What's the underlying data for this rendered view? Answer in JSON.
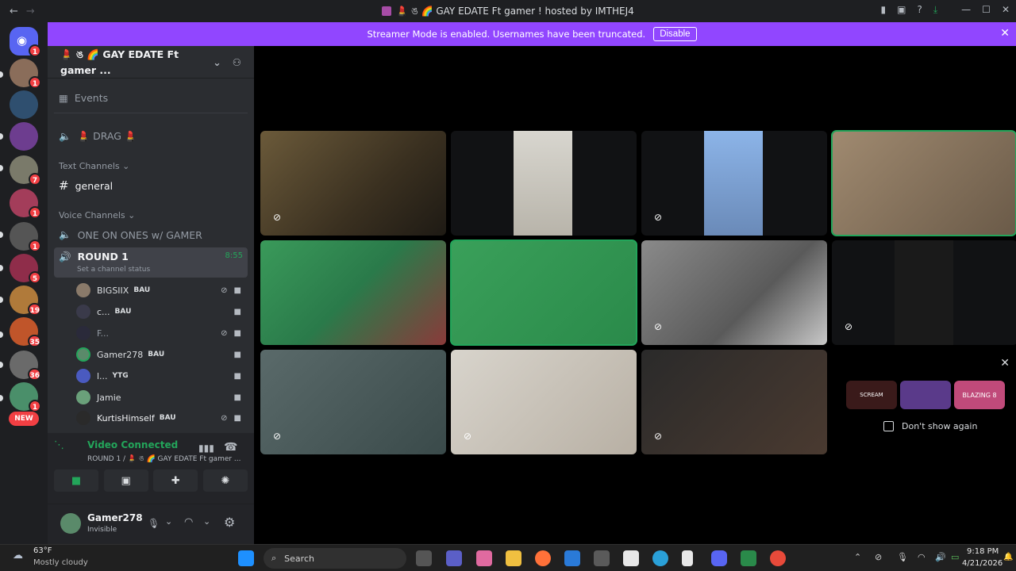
{
  "window": {
    "title": "💄 ঙ 🌈 GAY EDATE Ft gamer ! hosted by IMTHEJ4"
  },
  "banner": {
    "text": "Streamer Mode is enabled. Usernames have been truncated.",
    "disable_label": "Disable",
    "color": "#9146ff"
  },
  "guilds": {
    "badges": [
      "1",
      "1",
      "7",
      "1",
      "1",
      "5",
      "19",
      "35",
      "36",
      "1"
    ],
    "new_label": "NEW"
  },
  "server": {
    "name": "💄 ঙ 🌈 GAY EDATE Ft gamer ...",
    "events_label": "Events",
    "drag_channel": "💄 DRAG 💄",
    "text_category": "Text Channels",
    "general": "general",
    "voice_category": "Voice Channels",
    "one_on_ones": "ONE ON ONES w/ GAMER",
    "round1": "ROUND 1",
    "round1_timer": "8:55",
    "channel_status": "Set a channel status"
  },
  "members": [
    {
      "name": "BIGSIIX",
      "tag": "BAU"
    },
    {
      "name": "c...",
      "tag": "BAU"
    },
    {
      "name": "F...",
      "tag": ""
    },
    {
      "name": "Gamer278",
      "tag": "BAU"
    },
    {
      "name": "l...",
      "tag": "YTG"
    },
    {
      "name": "Jamie",
      "tag": ""
    },
    {
      "name": "KurtisHimself",
      "tag": "BAU"
    }
  ],
  "voice_panel": {
    "status": "Video Connected",
    "location": "ROUND 1 / 💄 ঙ 🌈 GAY EDATE Ft gamer ..."
  },
  "user": {
    "name": "Gamer278",
    "status": "Invisible"
  },
  "promo": {
    "dont_show": "Don't show again",
    "thumb_labels": [
      "SCREAM",
      "",
      "BLAZING 8"
    ]
  },
  "taskbar": {
    "weather_temp": "63°F",
    "weather_desc": "Mostly cloudy",
    "search": "Search",
    "time": "9:18 PM",
    "date": "4/21/2026"
  },
  "colors": {
    "accent_green": "#23a55a",
    "discord_blurple": "#5865f2",
    "badge_red": "#f23f43"
  }
}
